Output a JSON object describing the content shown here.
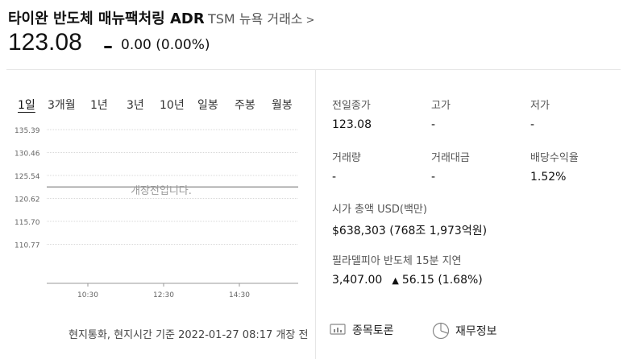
{
  "header": {
    "title": "타이완 반도체 매뉴팩처링 ADR",
    "ticker_exchange": "TSM 뉴욕 거래소",
    "chevron": ">"
  },
  "quote": {
    "price": "123.08",
    "change_symbol": "–",
    "change": "0.00 (0.00%)"
  },
  "tabs": [
    "1일",
    "3개월",
    "1년",
    "3년",
    "10년",
    "일봉",
    "주봉",
    "월봉"
  ],
  "active_tab": "1일",
  "chart_data": {
    "type": "line",
    "y_ticks": [
      "135.39",
      "130.46",
      "125.54",
      "120.62",
      "115.70",
      "110.77"
    ],
    "x_ticks": [
      "10:30",
      "12:30",
      "14:30"
    ],
    "ylim": [
      110.77,
      135.39
    ],
    "series": [
      {
        "values": [
          123.08
        ]
      }
    ],
    "message": "개장전입니다."
  },
  "footnote": "현지통화, 현지시간 기준 2022-01-27 08:17 개장 전",
  "stats": {
    "prev_close_label": "전일종가",
    "prev_close_value": "123.08",
    "high_label": "고가",
    "high_value": "-",
    "low_label": "저가",
    "low_value": "-",
    "volume_label": "거래량",
    "volume_value": "-",
    "turnover_label": "거래대금",
    "turnover_value": "-",
    "dividend_label": "배당수익율",
    "dividend_value": "1.52%"
  },
  "market_cap": {
    "label": "시가 총액 USD(백만)",
    "value": "$638,303 (768조 1,973억원)"
  },
  "sox": {
    "label": "필라델피아 반도체 15분 지연",
    "value": "3,407.00",
    "arrow": "▲",
    "change": "56.15 (1.68%)"
  },
  "actions": {
    "discussion": "종목토론",
    "financials": "재무정보"
  },
  "colors": {
    "up_red": "#e0283a",
    "text": "#111111",
    "muted": "#999999"
  }
}
